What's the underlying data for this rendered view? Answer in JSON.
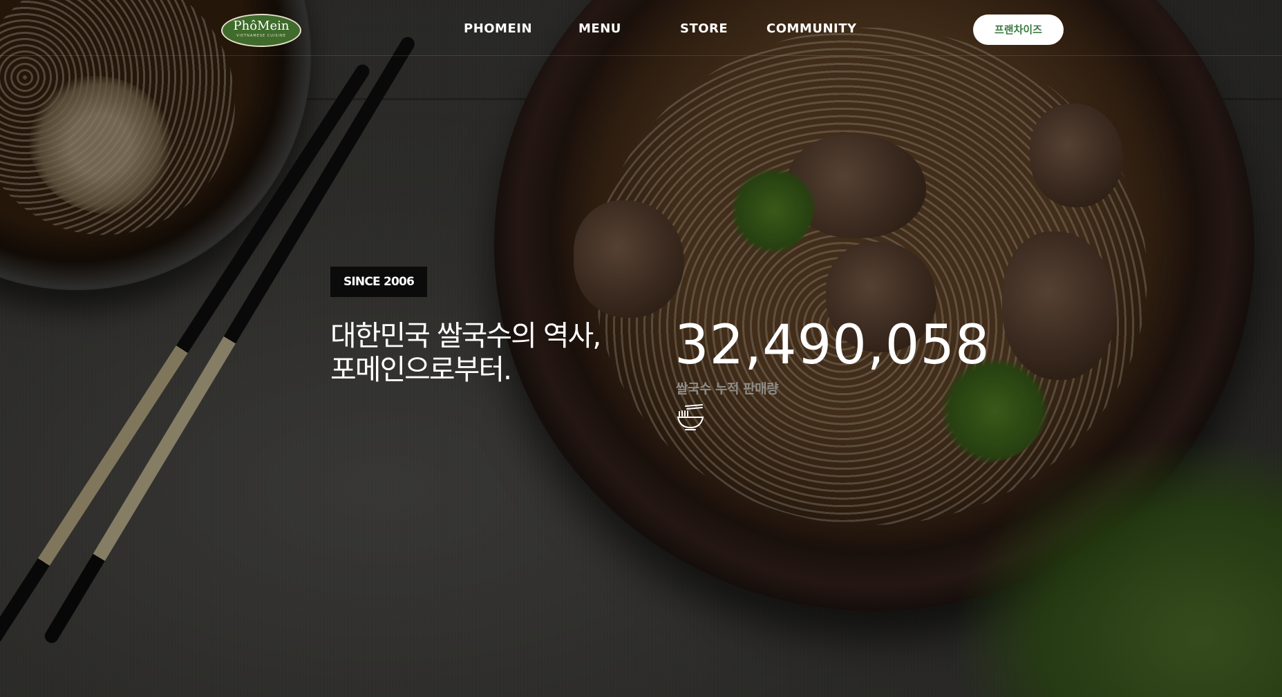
{
  "header": {
    "logo_text": "PhôMein",
    "logo_subtext": "VIETNAMESE CUISINE",
    "nav": {
      "phomein": "PHOMEIN",
      "menu": "MENU",
      "store": "STORE",
      "community": "COMMUNITY"
    },
    "franchise_button": "프랜차이즈"
  },
  "hero": {
    "since_badge": "SINCE 2006",
    "headline_line1": "대한민국 쌀국수의 역사,",
    "headline_line2": "포메인으로부터.",
    "counter_value": "32,490,058",
    "counter_label": "쌀국수 누적 판매량"
  },
  "icons": {
    "bowl": "noodle-bowl-icon"
  },
  "colors": {
    "logo_green": "#3f6b2c",
    "franchise_text": "#3a7a3f",
    "badge_bg": "#0b0b0b"
  }
}
